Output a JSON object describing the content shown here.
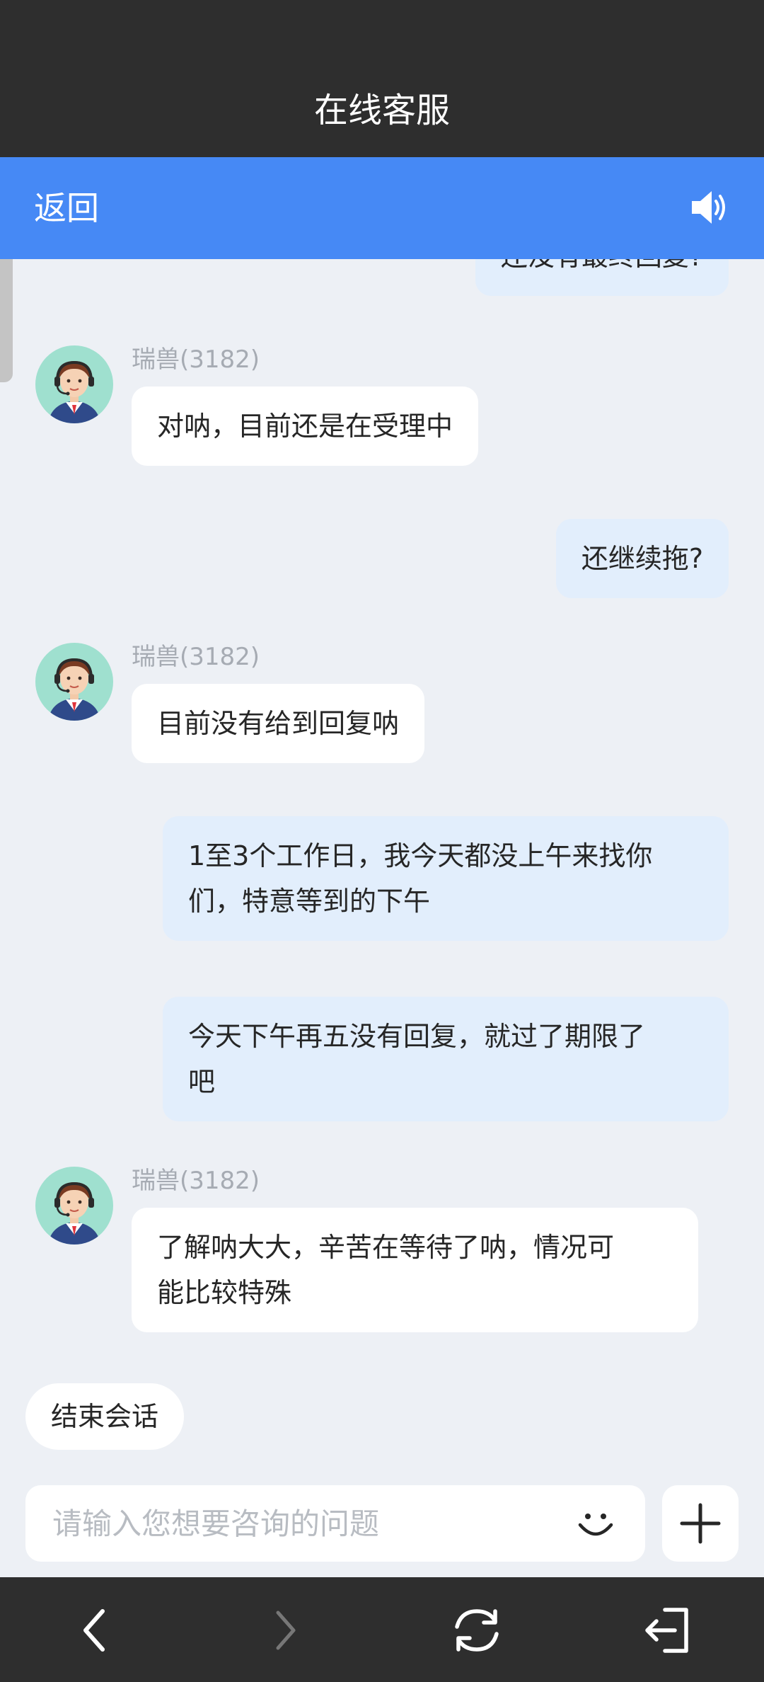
{
  "header": {
    "title": "在线客服"
  },
  "nav": {
    "back_label": "返回",
    "speaker_icon": "speaker-icon"
  },
  "messages": [
    {
      "role": "user",
      "text": "还没有最终回复?"
    },
    {
      "role": "agent",
      "name": "瑞兽(3182)",
      "text": "对呐，目前还是在受理中"
    },
    {
      "role": "user",
      "text": "还继续拖?"
    },
    {
      "role": "agent",
      "name": "瑞兽(3182)",
      "text": "目前没有给到回复呐"
    },
    {
      "role": "user",
      "lines": [
        "1至3个工作日，我今天都没上午来找你",
        "们，特意等到的下午"
      ]
    },
    {
      "role": "user",
      "lines": [
        "今天下午再五没有回复，就过了期限了",
        "吧"
      ]
    },
    {
      "role": "agent",
      "name": "瑞兽(3182)",
      "lines": [
        "了解呐大大，辛苦在等待了呐，情况可",
        "能比较特殊"
      ]
    }
  ],
  "actions": {
    "end_session_label": "结束会话"
  },
  "input": {
    "placeholder": "请输入您想要咨询的问题",
    "value": ""
  },
  "icons": {
    "emoji": "smiley-icon",
    "add": "plus-icon",
    "back": "chevron-left-icon",
    "forward": "chevron-right-icon",
    "refresh": "refresh-icon",
    "exit": "exit-icon"
  },
  "colors": {
    "primary": "#4689f5",
    "dark_bar": "#2e2e2e",
    "background": "#edf0f5",
    "user_bubble": "#e2eefc"
  }
}
